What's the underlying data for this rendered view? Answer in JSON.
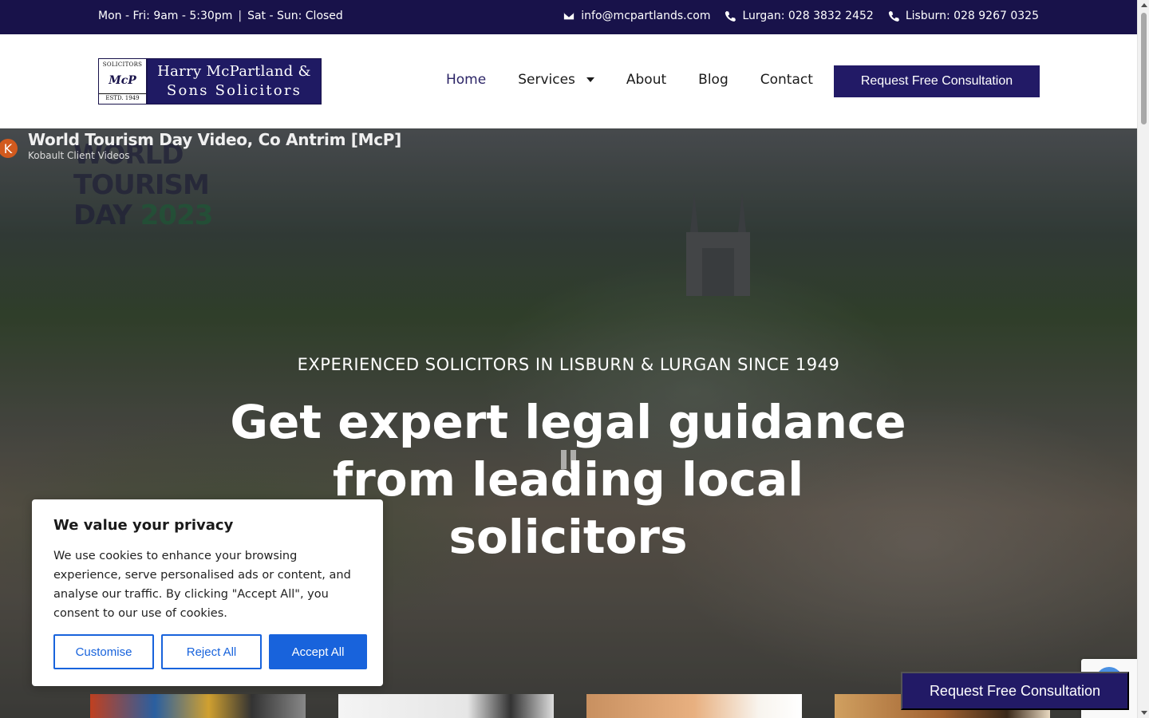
{
  "topbar": {
    "hours_weekday": "Mon - Fri: 9am - 5:30pm",
    "separator": "|",
    "hours_weekend": "Sat - Sun: Closed",
    "email": "info@mcpartlands.com",
    "phone_lurgan": "Lurgan: 028 3832 2452",
    "phone_lisburn": "Lisburn: 028 9267 0325"
  },
  "logo": {
    "mark_top": "SOLICITORS",
    "mark_initials": "McP",
    "mark_est": "ESTD. 1949",
    "name_line1": "Harry McPartland &",
    "name_line2": "Sons Solicitors"
  },
  "nav": {
    "items": [
      {
        "label": "Home",
        "active": true
      },
      {
        "label": "Services",
        "has_dropdown": true
      },
      {
        "label": "About"
      },
      {
        "label": "Blog"
      },
      {
        "label": "Contact"
      }
    ],
    "cta": "Request Free Consultation"
  },
  "video": {
    "title": "World Tourism Day Video, Co Antrim [McP]",
    "channel": "Kobault Client Videos",
    "avatar_letter": "K",
    "overlay_line1": "WORLD",
    "overlay_line2": "TOURISM",
    "overlay_line3a": "DAY",
    "overlay_line3b": "2023"
  },
  "hero": {
    "eyebrow": "EXPERIENCED SOLICITORS IN LISBURN & LURGAN SINCE 1949",
    "headline": "Get expert legal guidance from leading local solicitors"
  },
  "cookie": {
    "title": "We value your privacy",
    "body": "We use cookies to enhance your browsing experience, serve personalised ads or content, and analyse our traffic. By clicking \"Accept All\", you consent to our use of cookies.",
    "customise": "Customise",
    "reject": "Reject All",
    "accept": "Accept All"
  },
  "floating_cta": "Request Free Consultation",
  "colors": {
    "brand_navy": "#221a66",
    "topbar_bg": "#18124a",
    "cookie_blue": "#1863dc"
  }
}
